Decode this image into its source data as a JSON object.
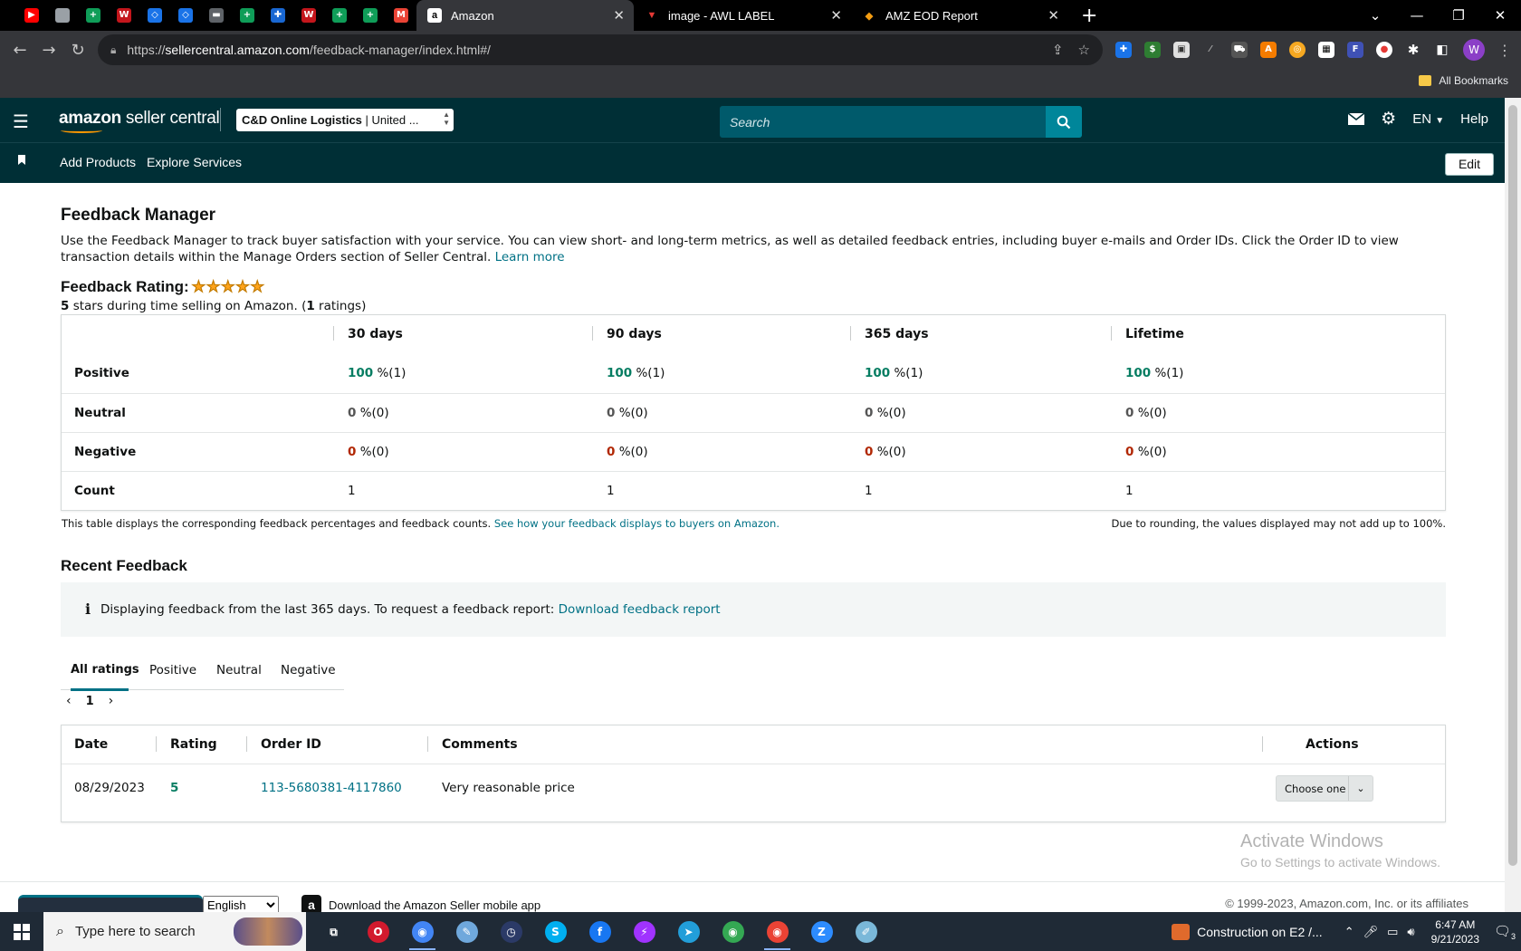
{
  "browser": {
    "pinned_tabs": [
      {
        "icon": "youtube-icon",
        "color": "#ff0000",
        "glyph": "▶"
      },
      {
        "icon": "sheets-grey-icon",
        "color": "#9aa0a6",
        "glyph": ""
      },
      {
        "icon": "sheets-icon",
        "color": "#0f9d58",
        "glyph": "+"
      },
      {
        "icon": "w-icon",
        "color": "#c4161c",
        "glyph": "W"
      },
      {
        "icon": "diamond-icon",
        "color": "#1a73e8",
        "glyph": "◇"
      },
      {
        "icon": "diamond-icon-2",
        "color": "#1a73e8",
        "glyph": "◇"
      },
      {
        "icon": "bank-icon",
        "color": "#5f6368",
        "glyph": "▬"
      },
      {
        "icon": "sheets-icon-2",
        "color": "#0f9d58",
        "glyph": "+"
      },
      {
        "icon": "blue-app-icon",
        "color": "#1967d2",
        "glyph": "✚"
      },
      {
        "icon": "w-icon-2",
        "color": "#c4161c",
        "glyph": "W"
      },
      {
        "icon": "sheets-icon-3",
        "color": "#0f9d58",
        "glyph": "+"
      },
      {
        "icon": "sheets-icon-4",
        "color": "#0f9d58",
        "glyph": "+"
      },
      {
        "icon": "gmail-icon",
        "color": "#ea4335",
        "glyph": "M"
      }
    ],
    "tabs": [
      {
        "title": "Amazon",
        "active": true
      },
      {
        "title": "image - AWL LABEL",
        "active": false
      },
      {
        "title": "AMZ EOD Report",
        "active": false
      }
    ],
    "url_prefix": "https://",
    "url_domain": "sellercentral.amazon.com",
    "url_path": "/feedback-manager/index.html#/",
    "bookmarks_label": "All Bookmarks",
    "profile_initial": "W"
  },
  "header": {
    "logo_bold": "amazon",
    "logo_rest": " seller central",
    "account_name": "C&D Online Logistics",
    "account_region": " | United ...",
    "search_placeholder": "Search",
    "language": "EN",
    "help": "Help"
  },
  "nav": {
    "links": [
      "Add Products",
      "Explore Services"
    ],
    "edit": "Edit"
  },
  "page": {
    "title": "Feedback Manager",
    "intro": "Use the Feedback Manager to track buyer satisfaction with your service. You can view short- and long-term metrics, as well as detailed feedback entries, including buyer e-mails and Order IDs. Click the Order ID to view transaction details within the Manage Orders section of Seller Central.",
    "learn_more": "Learn more",
    "rating_label": "Feedback Rating:",
    "stars": 5,
    "rating_sub_stars": "5",
    "rating_sub_mid": " stars during time selling on Amazon. (",
    "rating_sub_count": "1",
    "rating_sub_end": " ratings)"
  },
  "metrics": {
    "columns": [
      "30 days",
      "90 days",
      "365 days",
      "Lifetime"
    ],
    "rows": [
      {
        "label": "Positive",
        "values": [
          "100",
          "100",
          "100",
          "100"
        ],
        "counts": [
          "%(1)",
          "%(1)",
          "%(1)",
          "%(1)"
        ],
        "tone": "green"
      },
      {
        "label": "Neutral",
        "values": [
          "0",
          "0",
          "0",
          "0"
        ],
        "counts": [
          "%(0)",
          "%(0)",
          "%(0)",
          "%(0)"
        ],
        "tone": "zero"
      },
      {
        "label": "Negative",
        "values": [
          "0",
          "0",
          "0",
          "0"
        ],
        "counts": [
          "%(0)",
          "%(0)",
          "%(0)",
          "%(0)"
        ],
        "tone": "red"
      },
      {
        "label": "Count",
        "values": [
          "1",
          "1",
          "1",
          "1"
        ],
        "counts": [
          "",
          "",
          "",
          ""
        ],
        "tone": "count"
      }
    ],
    "footnote": "This table displays the corresponding feedback percentages and feedback counts.",
    "footnote_link": "See how your feedback displays to buyers on Amazon.",
    "rounding_note": "Due to rounding, the values displayed may not add up to 100%."
  },
  "recent": {
    "title": "Recent Feedback",
    "info_text": "Displaying feedback from the last 365 days. To request a feedback report:",
    "info_link": "Download feedback report",
    "tabs": [
      "All ratings",
      "Positive",
      "Neutral",
      "Negative"
    ],
    "page": "1",
    "headers": [
      "Date",
      "Rating",
      "Order ID",
      "Comments",
      "Actions"
    ],
    "rows": [
      {
        "date": "08/29/2023",
        "rating": "5",
        "order_id": "113-5680381-4117860",
        "comment": "Very reasonable price",
        "action": "Choose one"
      }
    ]
  },
  "watermark": {
    "line1": "Activate Windows",
    "line2": "Go to Settings to activate Windows."
  },
  "footer": {
    "language": "English",
    "mobile_app": "Download the Amazon Seller mobile app",
    "copyright": "© 1999-2023, Amazon.com, Inc. or its affiliates"
  },
  "taskbar": {
    "search_placeholder": "Type here to search",
    "apps": [
      {
        "name": "task-view-icon",
        "color": "#1f2a36",
        "glyph": "⧉"
      },
      {
        "name": "opera-icon",
        "color": "#d21a2e",
        "glyph": "O"
      },
      {
        "name": "chrome-icon",
        "color": "#4285f4",
        "glyph": "◉"
      },
      {
        "name": "paint-icon",
        "color": "#6fa8dc",
        "glyph": "✎"
      },
      {
        "name": "clock-app-icon",
        "color": "#2b3a67",
        "glyph": "◷"
      },
      {
        "name": "skype-icon",
        "color": "#00aff0",
        "glyph": "S"
      },
      {
        "name": "facebook-icon",
        "color": "#1877f2",
        "glyph": "f"
      },
      {
        "name": "messenger-icon",
        "color": "#a033ff",
        "glyph": "⚡"
      },
      {
        "name": "telegram-icon",
        "color": "#229ed9",
        "glyph": "➤"
      },
      {
        "name": "chrome-profile-icon",
        "color": "#34a853",
        "glyph": "◉"
      },
      {
        "name": "chrome-profile-2-icon",
        "color": "#ea4335",
        "glyph": "◉"
      },
      {
        "name": "zoom-icon",
        "color": "#2d8cff",
        "glyph": "Z"
      },
      {
        "name": "notes-icon",
        "color": "#7ab8d9",
        "glyph": "✐"
      }
    ],
    "news": "Construction on E2 /...",
    "time": "6:47 AM",
    "date": "9/21/2023",
    "notifications": "3"
  }
}
